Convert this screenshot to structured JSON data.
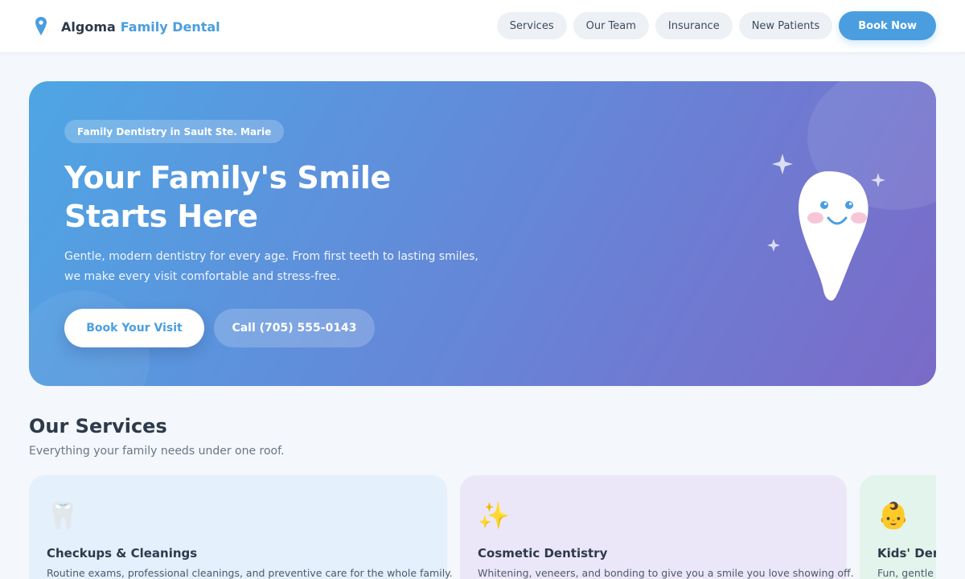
{
  "brand": {
    "name": "Algoma",
    "accent": "Family Dental"
  },
  "nav": {
    "items": [
      "Services",
      "Our Team",
      "Insurance",
      "New Patients"
    ],
    "cta": "Book Now"
  },
  "hero": {
    "badge": "Family Dentistry in Sault Ste. Marie",
    "title_line1": "Your Family's Smile",
    "title_line2": "Starts Here",
    "subtitle_line1": "Gentle, modern dentistry for every age. From first teeth to lasting smiles,",
    "subtitle_line2": "we make every visit comfortable and stress-free.",
    "primary_button": "Book Your Visit",
    "secondary_button": "Call (705) 555-0143"
  },
  "services": {
    "title": "Our Services",
    "subtitle": "Everything your family needs under one roof.",
    "cards": [
      {
        "icon": "🦷",
        "icon_name": "tooth-icon",
        "title": "Checkups & Cleanings",
        "desc": "Routine exams, professional cleanings, and preventive care for the whole family."
      },
      {
        "icon": "✨",
        "icon_name": "sparkles-icon",
        "title": "Cosmetic Dentistry",
        "desc": "Whitening, veneers, and bonding to give you a smile you love showing off."
      },
      {
        "icon": "👶",
        "icon_name": "baby-icon",
        "title": "Kids' Dentistry",
        "desc": "Fun, gentle visits"
      }
    ]
  },
  "colors": {
    "accent": "#4a9ee0",
    "hero_gradient_start": "#4ea6e4",
    "hero_gradient_end": "#7b6ac8",
    "text_dark": "#2d3a4a"
  }
}
